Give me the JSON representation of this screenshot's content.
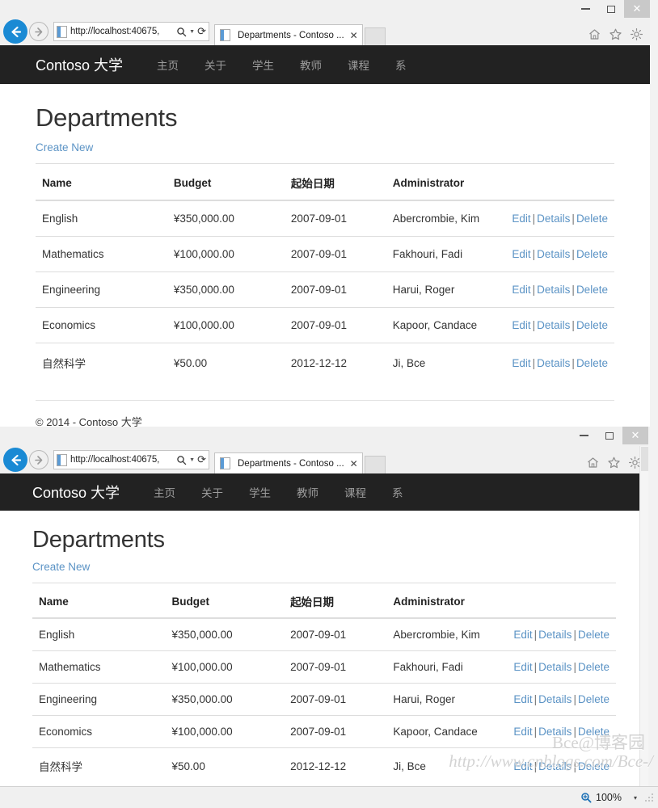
{
  "browser": {
    "window_controls": {
      "minimize": "—",
      "maximize": "▢",
      "close": "✕"
    },
    "address": {
      "url": "http://localhost:40675,",
      "placeholder": "",
      "search_icon": "search-icon",
      "dropdown_icon": "chevron-down-icon",
      "refresh_icon": "refresh-icon"
    },
    "tab": {
      "title": "Departments - Contoso ...",
      "close": "✕"
    },
    "toolbar_icons": [
      "home-icon",
      "favorites-star-icon",
      "settings-gear-icon"
    ],
    "back_label": "Back",
    "forward_label": "Forward",
    "newtab_label": "New tab"
  },
  "site": {
    "brand": "Contoso 大学",
    "nav": [
      {
        "label": "主页"
      },
      {
        "label": "关于"
      },
      {
        "label": "学生"
      },
      {
        "label": "教师"
      },
      {
        "label": "课程"
      },
      {
        "label": "系"
      }
    ],
    "page_title": "Departments",
    "create_new": "Create New",
    "footer": "© 2014 - Contoso 大学",
    "table": {
      "headers": [
        "Name",
        "Budget",
        "起始日期",
        "Administrator"
      ],
      "actions": {
        "edit": "Edit",
        "details": "Details",
        "delete": "Delete",
        "separator": "|"
      },
      "rows": [
        {
          "name": "English",
          "budget": "¥350,000.00",
          "date": "2007-09-01",
          "administrator": "Abercrombie, Kim"
        },
        {
          "name": "Mathematics",
          "budget": "¥100,000.00",
          "date": "2007-09-01",
          "administrator": "Fakhouri, Fadi"
        },
        {
          "name": "Engineering",
          "budget": "¥350,000.00",
          "date": "2007-09-01",
          "administrator": "Harui, Roger"
        },
        {
          "name": "Economics",
          "budget": "¥100,000.00",
          "date": "2007-09-01",
          "administrator": "Kapoor, Candace"
        },
        {
          "name": "自然科学",
          "budget": "¥50.00",
          "date": "2012-12-12",
          "administrator": "Ji, Bce"
        }
      ]
    }
  },
  "watermark": {
    "line1": "Bce@博客园",
    "line2": "http://www.cnblogs.com/Bce-/"
  },
  "statusbar": {
    "zoom_level": "100%",
    "zoom_icon": "magnifier-icon",
    "zoom_dropdown": "▾"
  },
  "colors": {
    "navbar": "#222222",
    "link": "#5b93c5",
    "back_button": "#1a8ad4",
    "text": "#333333",
    "border": "#dddddd"
  }
}
